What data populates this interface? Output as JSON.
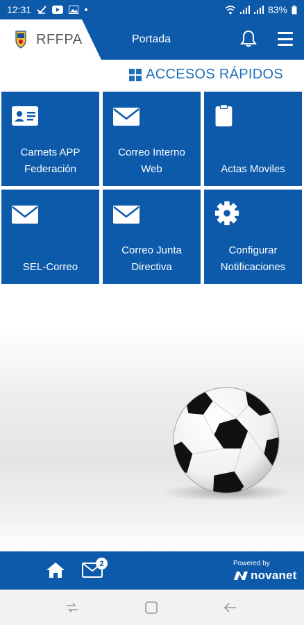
{
  "status_bar": {
    "time": "12:31",
    "battery": "83%"
  },
  "header": {
    "brand": "RFFPA",
    "title": "Portada"
  },
  "section": {
    "title": "ACCESOS RÁPIDOS"
  },
  "tiles": [
    {
      "label": "Carnets APP\nFederación",
      "icon": "id-card-icon"
    },
    {
      "label": "Correo Interno\nWeb",
      "icon": "mail-icon"
    },
    {
      "label": "Actas Moviles",
      "icon": "clipboard-icon"
    },
    {
      "label": "SEL-Correo",
      "icon": "mail-icon"
    },
    {
      "label": "Correo Junta\nDirectiva",
      "icon": "mail-icon"
    },
    {
      "label": "Configurar\nNotificaciones",
      "icon": "gear-icon"
    }
  ],
  "bottom_nav": {
    "mail_badge": "2",
    "powered_by": "Powered by",
    "vendor": "novanet"
  },
  "colors": {
    "primary": "#0d5aab",
    "accent": "#1f6fb8"
  }
}
